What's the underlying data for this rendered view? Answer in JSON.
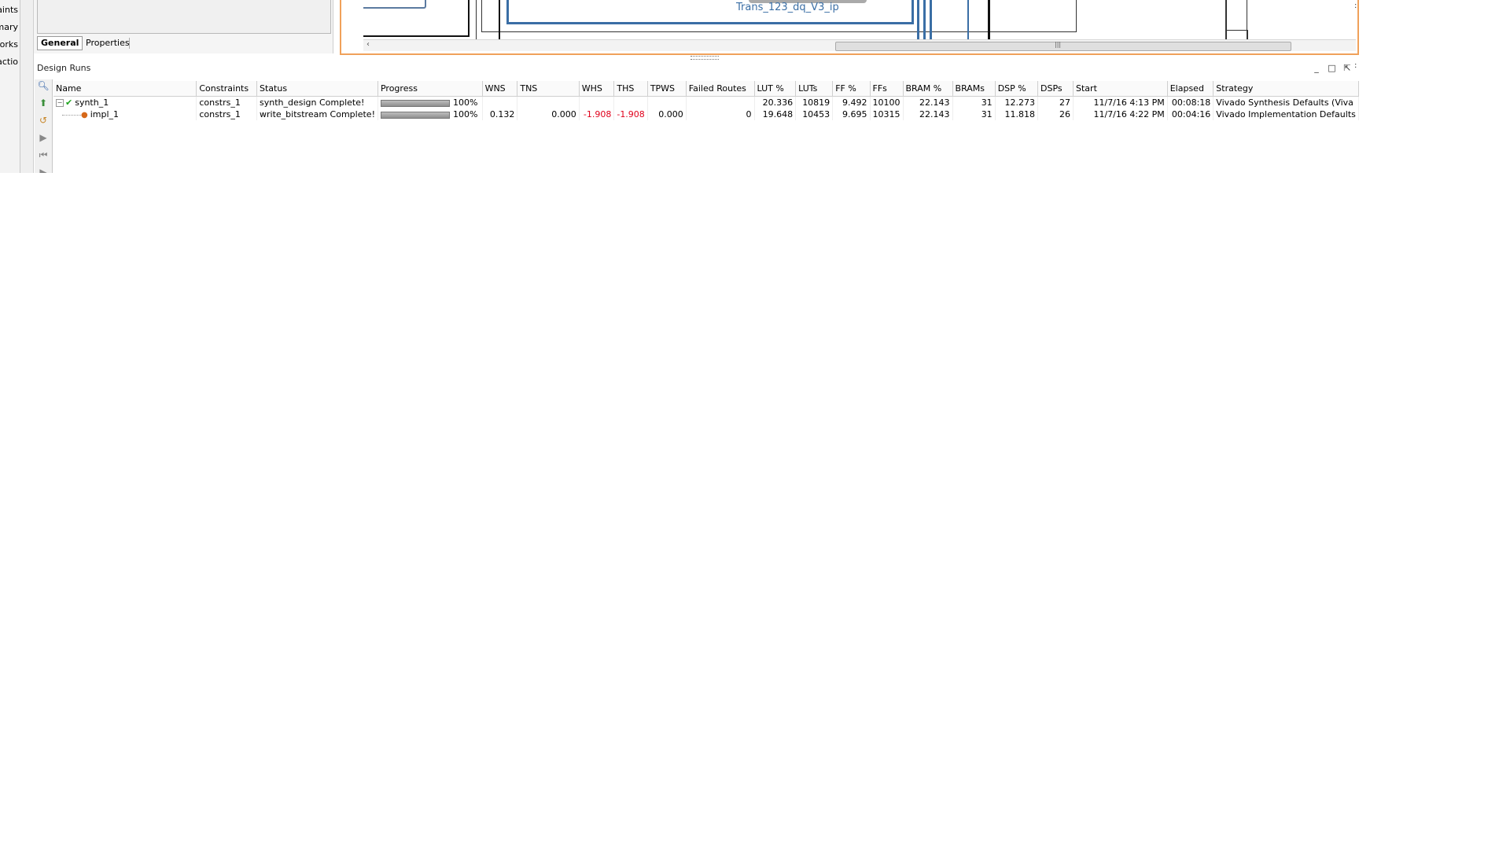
{
  "left_strip": {
    "items": [
      "aints",
      "mary",
      "orks",
      "actio"
    ]
  },
  "properties": {
    "tabs": [
      "General",
      "Properties"
    ]
  },
  "canvas": {
    "block_label": "Trans_123_dq_V3_ip",
    "scroll_left_arrow": "‹",
    "scroll_grip": "|||"
  },
  "design_runs": {
    "title": "Design Runs",
    "window_buttons": [
      "_",
      "□",
      "⇱"
    ],
    "toolbar_icons": [
      "search-icon",
      "launch-runs-icon",
      "reset-runs-icon",
      "play-icon",
      "first-icon",
      "next-icon"
    ],
    "columns": [
      "Name",
      "Constraints",
      "Status",
      "Progress",
      "WNS",
      "TNS",
      "WHS",
      "THS",
      "TPWS",
      "Failed Routes",
      "LUT %",
      "LUTs",
      "FF %",
      "FFs",
      "BRAM %",
      "BRAMs",
      "DSP %",
      "DSPs",
      "Start",
      "Elapsed",
      "Strategy"
    ],
    "rows": [
      {
        "name": "synth_1",
        "constraints": "constrs_1",
        "status": "synth_design Complete!",
        "progress": 100,
        "progress_label": "100%",
        "wns": "",
        "tns": "",
        "whs": "",
        "ths": "",
        "tpws": "",
        "failed_routes": "",
        "lut_pct": "20.336",
        "luts": "10819",
        "ff_pct": "9.492",
        "ffs": "10100",
        "bram_pct": "22.143",
        "brams": "31",
        "dsp_pct": "12.273",
        "dsps": "27",
        "start": "11/7/16 4:13 PM",
        "elapsed": "00:08:18",
        "strategy": "Vivado Synthesis Defaults (Viva"
      },
      {
        "name": "impl_1",
        "constraints": "constrs_1",
        "status": "write_bitstream Complete!",
        "progress": 100,
        "progress_label": "100%",
        "wns": "0.132",
        "tns": "0.000",
        "whs": "-1.908",
        "ths": "-1.908",
        "tpws": "0.000",
        "failed_routes": "0",
        "lut_pct": "19.648",
        "luts": "10453",
        "ff_pct": "9.695",
        "ffs": "10315",
        "bram_pct": "22.143",
        "brams": "31",
        "dsp_pct": "11.818",
        "dsps": "26",
        "start": "11/7/16 4:22 PM",
        "elapsed": "00:04:16",
        "strategy": "Vivado Implementation Defaults"
      }
    ]
  },
  "colors": {
    "canvas_border": "#f0a15a",
    "wire_blue": "#3a6ea5",
    "negative_value": "#e0001b",
    "complete_check": "#1ea31e"
  }
}
